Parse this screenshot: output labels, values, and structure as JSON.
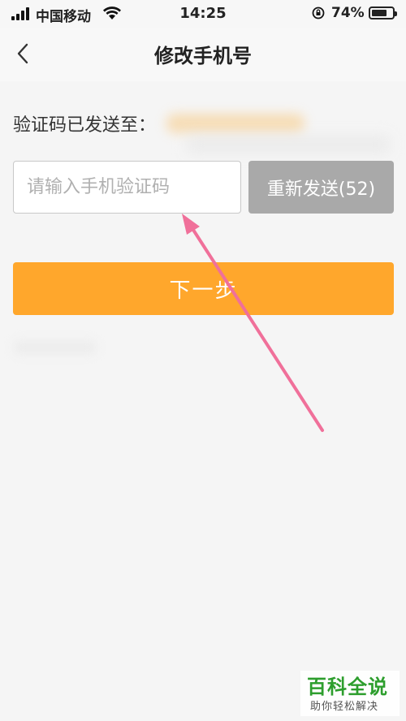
{
  "status_bar": {
    "carrier": "中国移动",
    "time": "14:25",
    "battery_percent": "74%",
    "battery_level": 0.74
  },
  "nav": {
    "title": "修改手机号",
    "back_icon": "chevron-left-icon"
  },
  "form": {
    "sent_label": "验证码已发送至：",
    "code_placeholder": "请输入手机验证码",
    "code_value": "",
    "resend_label": "重新发送(52)",
    "next_label": "下一步"
  },
  "colors": {
    "accent": "#ffa72c",
    "resend_disabled": "#a9a9a9",
    "annotation_arrow": "#f0709a",
    "watermark_green": "#2d9e2d"
  },
  "watermark": {
    "main": "百科全说",
    "sub": "助你轻松解决"
  }
}
